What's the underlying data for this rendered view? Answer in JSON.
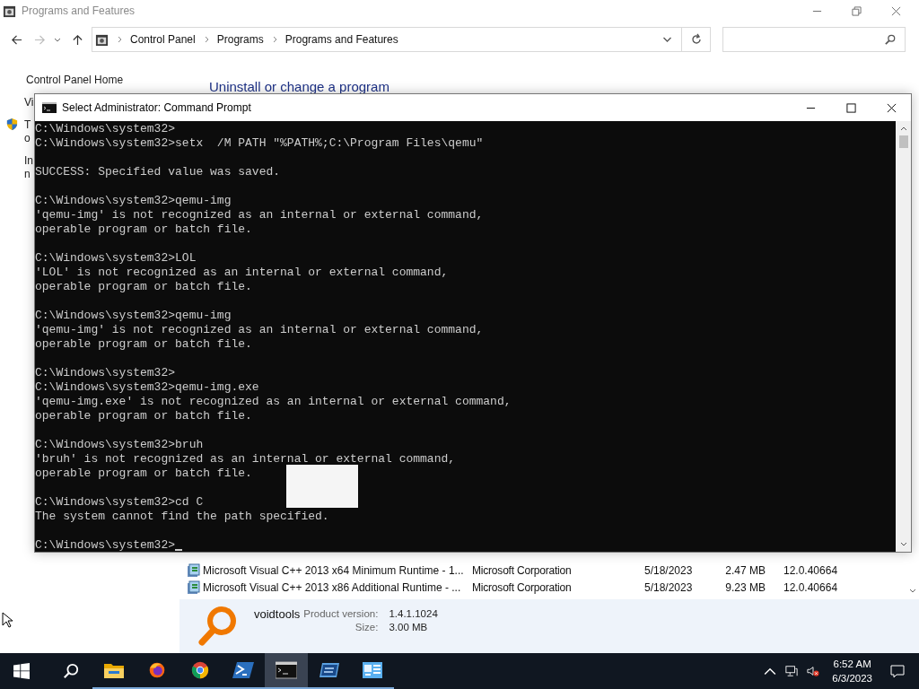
{
  "window": {
    "title": "Programs and Features"
  },
  "address_bar": {
    "breadcrumb": [
      "Control Panel",
      "Programs",
      "Programs and Features"
    ]
  },
  "sidebar": {
    "home_link": "Control Panel Home",
    "items": [
      {
        "text": "Vi",
        "kind": "link"
      },
      {
        "text": "T",
        "kind": "shield"
      },
      {
        "text": "o",
        "kind": "cont"
      },
      {
        "text": "In",
        "kind": "link"
      },
      {
        "text": "n",
        "kind": "cont"
      }
    ]
  },
  "heading": "Uninstall or change a program",
  "programs": [
    {
      "name": "Microsoft Visual C++ 2013 x64 Minimum Runtime - 1...",
      "publisher": "Microsoft Corporation",
      "installed": "5/18/2023",
      "size": "2.47 MB",
      "version": "12.0.40664"
    },
    {
      "name": "Microsoft Visual C++ 2013 x86 Additional Runtime - ...",
      "publisher": "Microsoft Corporation",
      "installed": "5/18/2023",
      "size": "9.23 MB",
      "version": "12.0.40664"
    }
  ],
  "details": {
    "publisher": "voidtools",
    "version_label": "Product version:",
    "version": "1.4.1.1024",
    "size_label": "Size:",
    "size": "3.00 MB"
  },
  "console": {
    "title": "Select Administrator:  Command Prompt",
    "blocks": [
      [
        "C:\\Windows\\system32>",
        "C:\\Windows\\system32>setx  /M PATH \"%PATH%;C:\\Program Files\\qemu\""
      ],
      [
        "SUCCESS: Specified value was saved."
      ],
      [
        "C:\\Windows\\system32>qemu-img",
        "'qemu-img' is not recognized as an internal or external command,",
        "operable program or batch file."
      ],
      [
        "C:\\Windows\\system32>LOL",
        "'LOL' is not recognized as an internal or external command,",
        "operable program or batch file."
      ],
      [
        "C:\\Windows\\system32>qemu-img",
        "'qemu-img' is not recognized as an internal or external command,",
        "operable program or batch file."
      ],
      [
        "C:\\Windows\\system32>",
        "C:\\Windows\\system32>qemu-img.exe",
        "'qemu-img.exe' is not recognized as an internal or external command,",
        "operable program or batch file."
      ],
      [
        "C:\\Windows\\system32>bruh",
        "'bruh' is not recognized as an internal or external command,",
        "operable program or batch file."
      ],
      [
        "C:\\Windows\\system32>cd C",
        "The system cannot find the path specified."
      ],
      [
        "C:\\Windows\\system32>"
      ]
    ]
  },
  "taskbar": {
    "apps": [
      {
        "kind": "explorer",
        "running": true,
        "selected": false
      },
      {
        "kind": "firefox",
        "running": true,
        "selected": false
      },
      {
        "kind": "chrome",
        "running": true,
        "selected": false
      },
      {
        "kind": "powershell",
        "running": true,
        "selected": false
      },
      {
        "kind": "cmd",
        "running": true,
        "selected": true
      },
      {
        "kind": "remote",
        "running": true,
        "selected": false
      },
      {
        "kind": "control",
        "running": true,
        "selected": false
      }
    ],
    "time": "6:52 AM",
    "date": "6/3/2023"
  }
}
